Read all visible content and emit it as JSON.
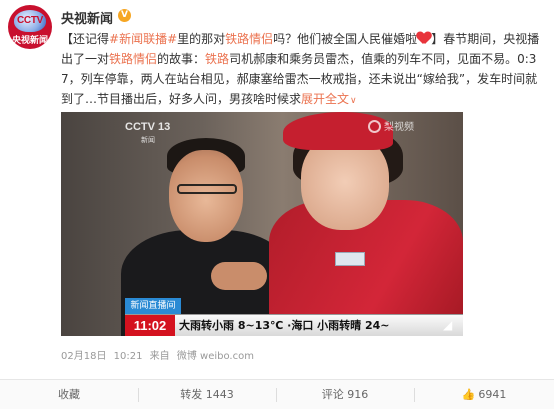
{
  "post": {
    "username": "央视新闻",
    "avatar": {
      "logo_text": "CCTV",
      "name_text": "央视新闻"
    },
    "text": {
      "p1": "【还记得",
      "tag1": "#新闻联播#",
      "p2": "里的那对",
      "tag2": "铁路情侣",
      "p3": "吗？他们被全国人民催婚啦",
      "p4": "】春节期间，央视播出了一对",
      "tag3": "铁路情侣",
      "p5": "的故事：",
      "tag4": "铁路",
      "p6": "司机郝康和乘务员雷杰，值乘的列车不同，见面不易。0:37，列车停靠，两人在站台相见，郝康塞给雷杰一枚戒指，还未说出“嫁给我”，发车时间就到了…节目播出后，好多人问，男孩啥时候求",
      "expand": "展开全文"
    },
    "video": {
      "channel_logo": "CCTV 13",
      "channel_sub": "新闻",
      "watermark": "梨视频",
      "news_tag": "新闻直播间",
      "ticker_time": "11:02",
      "ticker_text": "大雨转小雨  8~13℃ ·海口  小雨转晴  24~"
    },
    "meta": {
      "date": "02月18日",
      "time": "10:21",
      "from": "来自",
      "source": "微博 weibo.com"
    },
    "actions": {
      "favorite": "收藏",
      "repost": "转发 1443",
      "comment": "评论 916",
      "like": "6941"
    },
    "colors": {
      "accent": "#eb7350",
      "ticker_red": "#d4121f",
      "news_blue": "#2a8ad4"
    }
  }
}
